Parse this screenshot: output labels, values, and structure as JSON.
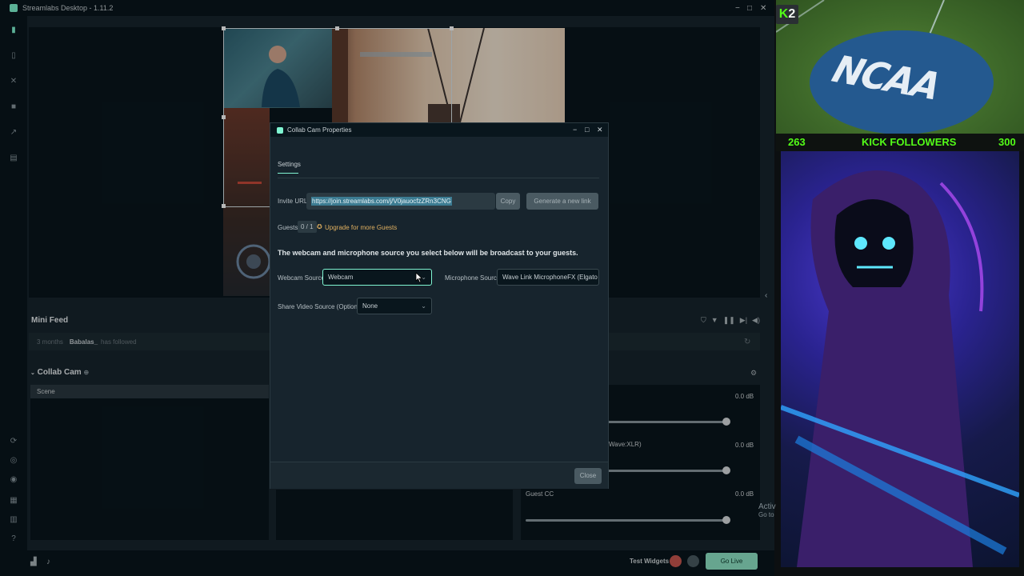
{
  "app": {
    "title": "Streamlabs Desktop - 1.11.2",
    "window_controls": [
      "−",
      "□",
      "✕"
    ]
  },
  "mini_feed": {
    "title": "Mini Feed",
    "item": {
      "time": "3 months",
      "user": "Babalas_",
      "action": "has followed"
    }
  },
  "scenes": {
    "title": "Collab Cam",
    "rows": [
      "Scene"
    ]
  },
  "mixer": {
    "rows": [
      {
        "name": "",
        "level": "0.0 dB"
      },
      {
        "name": "Wave:XLR)",
        "level": "0.0 dB"
      },
      {
        "name": "Guest CC",
        "level": "0.0 dB"
      }
    ]
  },
  "footer": {
    "test_widgets": "Test Widgets",
    "go_live": "Go Live"
  },
  "dialog": {
    "title": "Collab Cam Properties",
    "tab": "Settings",
    "invite_url_label": "Invite URL",
    "invite_url": "https://join.streamlabs.com/j/V0jauocfzZRn3CNG",
    "copy_label": "Copy",
    "generate_label": "Generate a new link",
    "guests_label": "Guests",
    "guests_count": "0 / 1",
    "upgrade_label": "Upgrade for more Guests",
    "note": "The webcam and microphone source you select below will be broadcast to your guests.",
    "webcam_label": "Webcam Source",
    "webcam_value": "Webcam",
    "mic_label": "Microphone Source",
    "mic_value": "Wave Link MicrophoneFX (Elgato Wave",
    "share_label": "Share Video Source (Optional)",
    "share_value": "None",
    "close_label": "Close"
  },
  "overlay": {
    "ncaa": "NCAA",
    "kick_letter": "K",
    "kick_num": "2",
    "followers_current": "263",
    "followers_label": "KICK FOLLOWERS",
    "followers_goal": "300"
  },
  "windows_text": [
    "Activ",
    "Go to"
  ],
  "colors": {
    "accent": "#80f5d2",
    "kick_green": "#53fc18",
    "panel": "#09161d",
    "background": "#17242d"
  }
}
